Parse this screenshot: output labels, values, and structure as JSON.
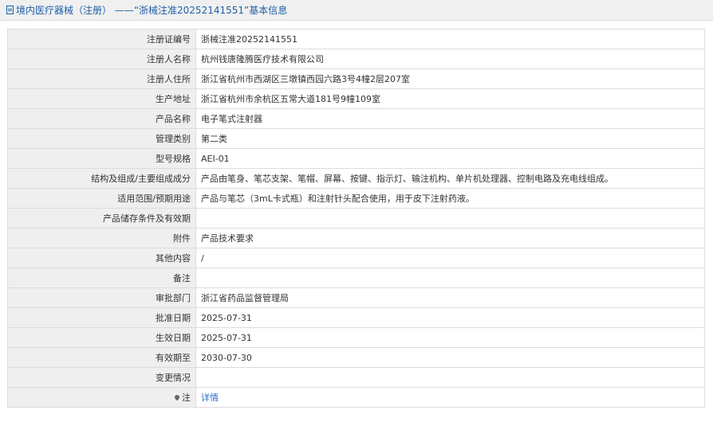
{
  "header": {
    "title": "境内医疗器械（注册） ——“浙械注准20252141551”基本信息",
    "icon": "document-icon",
    "color": "#1f5fa8"
  },
  "rows": [
    {
      "label": "注册证编号",
      "value": "浙械注准20252141551"
    },
    {
      "label": "注册人名称",
      "value": "杭州钱唐隆腾医疗技术有限公司"
    },
    {
      "label": "注册人住所",
      "value": "浙江省杭州市西湖区三墩镇西园六路3号4幢2层207室"
    },
    {
      "label": "生产地址",
      "value": "浙江省杭州市余杭区五常大道181号9幢109室"
    },
    {
      "label": "产品名称",
      "value": "电子笔式注射器"
    },
    {
      "label": "管理类别",
      "value": "第二类"
    },
    {
      "label": "型号规格",
      "value": "AEI-01"
    },
    {
      "label": "结构及组成/主要组成成分",
      "value": "产品由笔身、笔芯支架、笔帽、屏幕、按键、指示灯、输注机构、单片机处理器、控制电路及充电线组成。"
    },
    {
      "label": "适用范围/预期用途",
      "value": "产品与笔芯（3mL卡式瓶）和注射针头配合使用，用于皮下注射药液。"
    },
    {
      "label": "产品储存条件及有效期",
      "value": ""
    },
    {
      "label": "附件",
      "value": "产品技术要求"
    },
    {
      "label": "其他内容",
      "value": "/"
    },
    {
      "label": "备注",
      "value": ""
    },
    {
      "label": "审批部门",
      "value": "浙江省药品监督管理局"
    },
    {
      "label": "批准日期",
      "value": "2025-07-31"
    },
    {
      "label": "生效日期",
      "value": "2025-07-31"
    },
    {
      "label": "有效期至",
      "value": "2030-07-30"
    },
    {
      "label": "变更情况",
      "value": ""
    }
  ],
  "note_row": {
    "label": "注",
    "icon": "pin-icon",
    "link_text": "详情"
  }
}
